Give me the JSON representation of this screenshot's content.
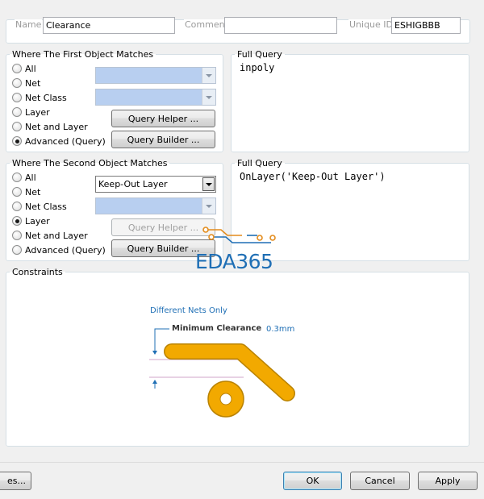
{
  "header": {
    "name_label": "Name",
    "name_value": "Clearance",
    "comment_label": "Comment",
    "comment_value": "",
    "uid_label": "Unique ID",
    "uid_value": "ESHIGBBB"
  },
  "first_match": {
    "legend": "Where The First Object Matches",
    "options": [
      "All",
      "Net",
      "Net Class",
      "Layer",
      "Net and Layer",
      "Advanced (Query)"
    ],
    "selected": "Advanced (Query)",
    "query_helper": "Query Helper ...",
    "query_builder": "Query Builder ..."
  },
  "first_query": {
    "legend": "Full Query",
    "text": "inpoly"
  },
  "second_match": {
    "legend": "Where The Second Object Matches",
    "options": [
      "All",
      "Net",
      "Net Class",
      "Layer",
      "Net and Layer",
      "Advanced (Query)"
    ],
    "selected": "Layer",
    "layer_combo": "Keep-Out Layer",
    "query_helper": "Query Helper ...",
    "query_builder": "Query Builder ..."
  },
  "second_query": {
    "legend": "Full Query",
    "text": "OnLayer('Keep-Out Layer')"
  },
  "watermark": {
    "text": "EDA365"
  },
  "constraints": {
    "legend": "Constraints",
    "different_nets": "Different Nets Only",
    "min_clearance_label": "Minimum Clearance",
    "min_clearance_value": "0.3mm"
  },
  "footer": {
    "left_button": "es...",
    "ok": "OK",
    "cancel": "Cancel",
    "apply": "Apply"
  },
  "colors": {
    "accent_blue": "#1f6fb5",
    "track_gold": "#f2a900",
    "watermark_orange": "#e38c1d"
  }
}
